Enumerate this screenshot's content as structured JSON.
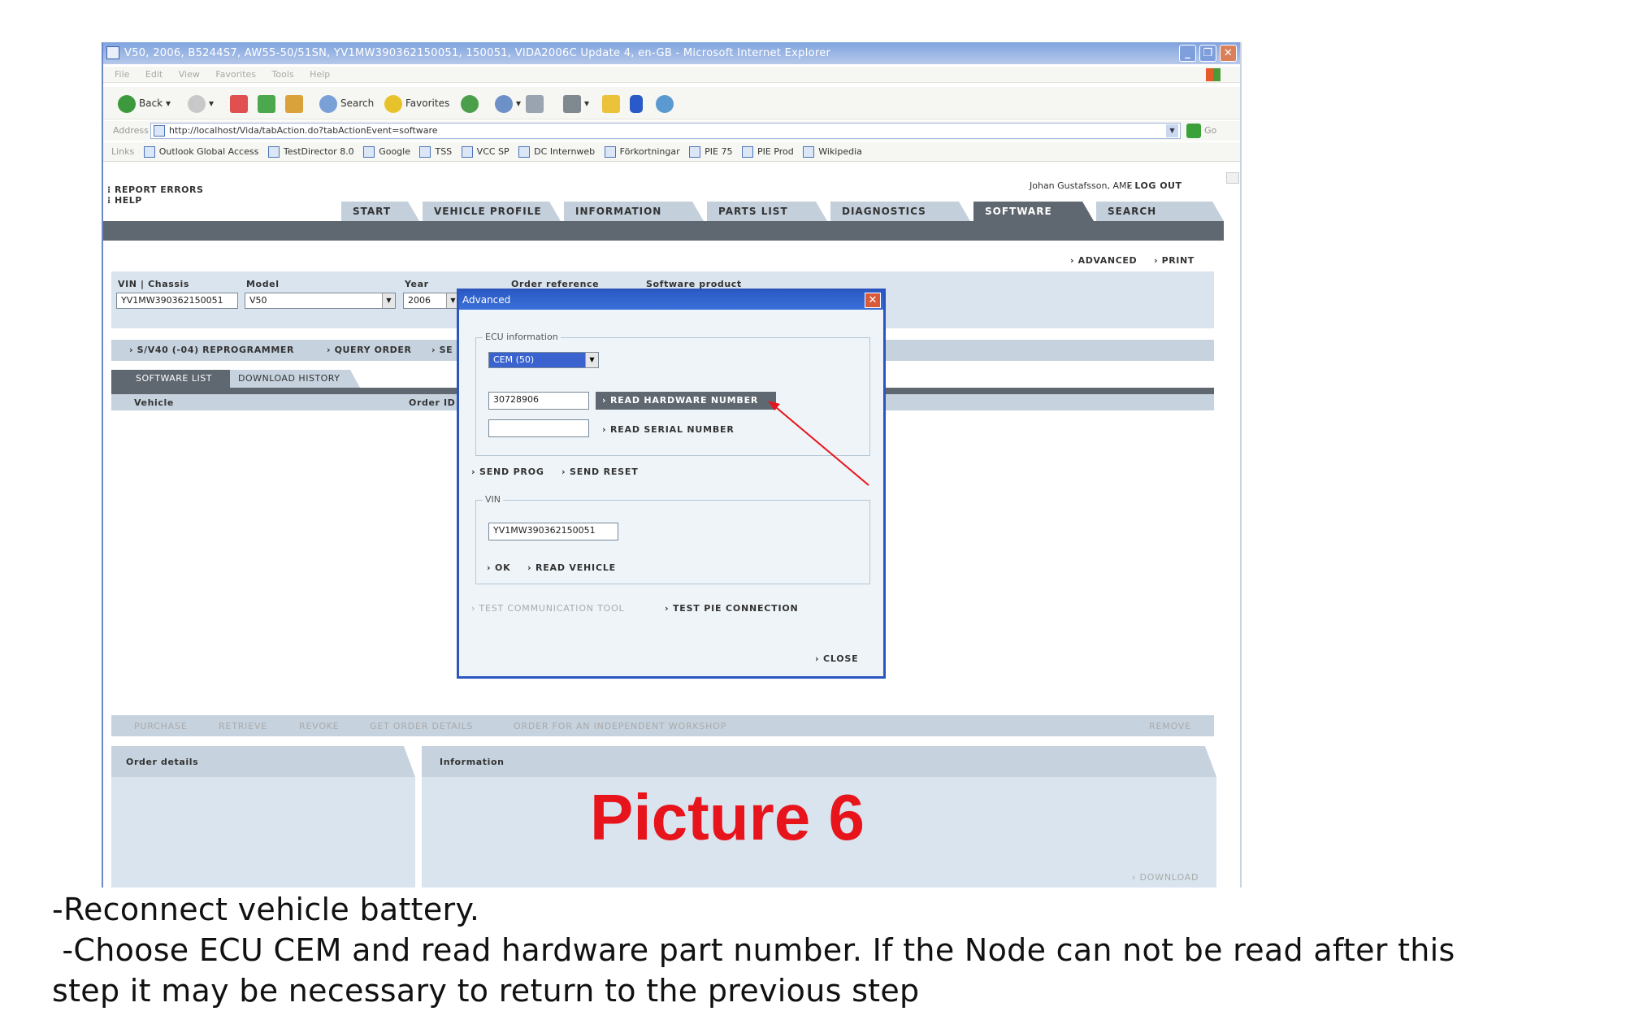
{
  "window": {
    "title": "V50, 2006, B5244S7, AW55-50/51SN, YV1MW390362150051, 150051, VIDA2006C Update 4, en-GB - Microsoft Internet Explorer"
  },
  "menu": [
    "File",
    "Edit",
    "View",
    "Favorites",
    "Tools",
    "Help"
  ],
  "toolbar": {
    "back": "Back",
    "search": "Search",
    "favorites": "Favorites"
  },
  "address": {
    "label": "Address",
    "url": "http://localhost/Vida/tabAction.do?tabActionEvent=software",
    "go": "Go"
  },
  "links": {
    "label": "Links",
    "items": [
      "Outlook Global Access",
      "TestDirector 8.0",
      "Google",
      "TSS",
      "VCC SP",
      "DC Internweb",
      "Förkortningar",
      "PIE 75",
      "PIE Prod",
      "Wikipedia"
    ]
  },
  "app": {
    "report_errors": "REPORT ERRORS",
    "help": "HELP",
    "user": "Johan Gustafsson, AME",
    "logout": "LOG OUT",
    "tabs": [
      "START",
      "VEHICLE PROFILE",
      "INFORMATION",
      "PARTS LIST",
      "DIAGNOSTICS",
      "SOFTWARE",
      "SEARCH"
    ],
    "advanced": "ADVANCED",
    "print": "PRINT",
    "fields": {
      "vin_label": "VIN | Chassis",
      "vin_value": "YV1MW390362150051",
      "model_label": "Model",
      "model_value": "V50",
      "year_label": "Year",
      "year_value": "2006",
      "order_ref_label": "Order reference",
      "sw_product_label": "Software product"
    },
    "actions": {
      "reprogrammer": "S/V40 (-04) REPROGRAMMER",
      "query_order": "QUERY ORDER",
      "se": "SE"
    },
    "subtabs": [
      "SOFTWARE LIST",
      "DOWNLOAD HISTORY"
    ],
    "list_headers": {
      "vehicle": "Vehicle",
      "order_id": "Order ID"
    },
    "bottom_actions": [
      "PURCHASE",
      "RETRIEVE",
      "REVOKE",
      "GET ORDER DETAILS",
      "ORDER FOR AN INDEPENDENT WORKSHOP"
    ],
    "remove": "REMOVE",
    "order_details": "Order details",
    "information": "Information",
    "download": "DOWNLOAD"
  },
  "dialog": {
    "title": "Advanced",
    "ecu_legend": "ECU information",
    "ecu_selected": "CEM (50)",
    "hardware_value": "30728906",
    "read_hw": "READ HARDWARE NUMBER",
    "serial_value": "",
    "read_serial": "READ SERIAL NUMBER",
    "send_prog": "SEND PROG",
    "send_reset": "SEND RESET",
    "vin_legend": "VIN",
    "vin_value": "YV1MW390362150051",
    "ok": "OK",
    "read_vehicle": "READ VEHICLE",
    "test_comm": "TEST COMMUNICATION TOOL",
    "test_pie": "TEST PIE CONNECTION",
    "close": "CLOSE"
  },
  "picture_label": "Picture 6",
  "instructions": [
    "-Reconnect vehicle battery.",
    " -Choose ECU CEM and read hardware part number. If the Node can not be read after this",
    "step it may be necessary to return to the previous step"
  ],
  "colors": {
    "annotation": "#e8141c",
    "dialog_border": "#2c55c0",
    "tab_dark": "#5f6770",
    "panel": "#d9e4ee"
  }
}
